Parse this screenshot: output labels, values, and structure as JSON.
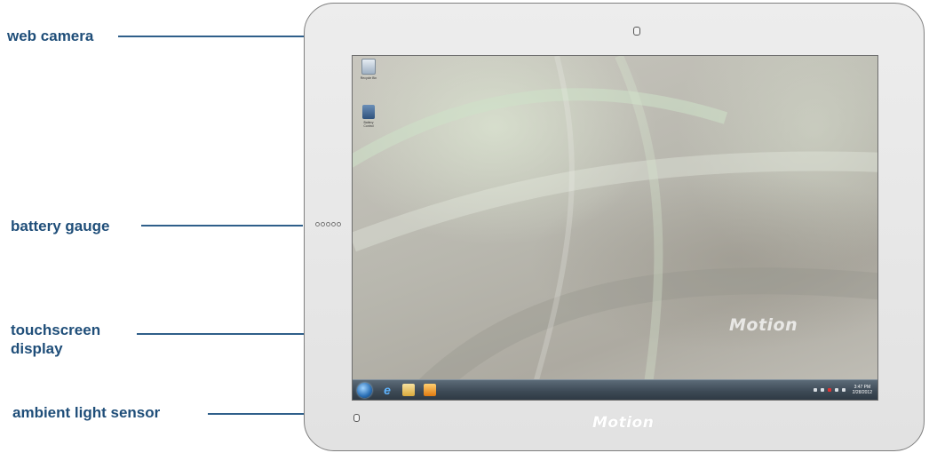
{
  "callouts": {
    "web_camera": "web camera",
    "battery_gauge": "battery gauge",
    "touchscreen_display_line1": "touchscreen",
    "touchscreen_display_line2": "display",
    "ambient_light_sensor": "ambient light sensor"
  },
  "desktop": {
    "icons": [
      {
        "label_line1": "Recycle Bin",
        "label_line2": "",
        "icon": "recycle-bin-icon"
      },
      {
        "label_line1": "Battery",
        "label_line2": "Control",
        "icon": "battery-control-icon"
      }
    ],
    "watermark": "Motion",
    "taskbar": {
      "apps": [
        "start-orb-icon",
        "internet-explorer-icon",
        "file-explorer-icon",
        "media-player-icon"
      ],
      "clock_time": "3:47 PM",
      "clock_date": "2/28/2012"
    }
  },
  "bezel_logo": "Motion",
  "colors": {
    "label_text": "#1f4e79",
    "callout_line": "#2f5f8a",
    "bezel": "#e8e8e8"
  }
}
